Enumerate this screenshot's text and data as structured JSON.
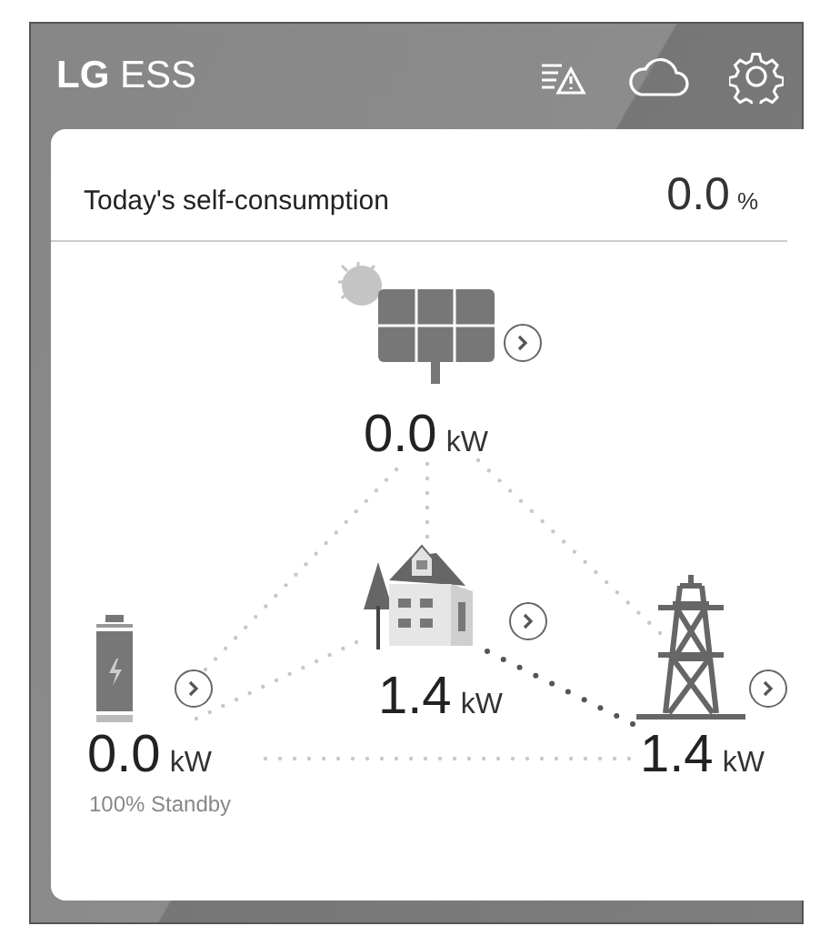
{
  "header": {
    "title": "**LG** ESS"
  },
  "summary": {
    "label": "Today's self-consumption",
    "value": "0.0",
    "unit": "%"
  },
  "nodes": [
    {
      "kind": "solar",
      "value": "0.0",
      "unit": "kW"
    },
    {
      "kind": "home",
      "value": "1.4",
      "unit": "kW"
    },
    {
      "kind": "battery",
      "value": "0.0",
      "unit": "kW",
      "status": "100% Standby"
    },
    {
      "kind": "grid",
      "value": "1.4",
      "unit": "kW"
    }
  ],
  "flows": [
    {
      "kind": "solar-battery",
      "active": false
    },
    {
      "kind": "solar-home",
      "active": false
    },
    {
      "kind": "solar-grid",
      "active": false
    },
    {
      "kind": "home-battery",
      "active": false
    },
    {
      "kind": "home-grid",
      "active": true
    },
    {
      "kind": "battery-grid",
      "active": false
    }
  ]
}
